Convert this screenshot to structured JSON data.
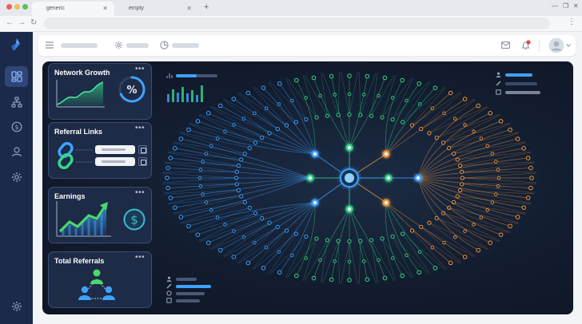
{
  "browser": {
    "tabs": [
      {
        "label": "generic",
        "active": true
      },
      {
        "label": "empty",
        "active": false
      }
    ],
    "new_tab_icon": "plus-icon",
    "window_controls": [
      "minimize-icon",
      "restore-icon",
      "close-icon"
    ],
    "traffic_light_colors": [
      "#ee5f57",
      "#f5bd4f",
      "#5ac05a"
    ]
  },
  "sidebar": {
    "logo_icon": "brand-logo-icon",
    "items": [
      {
        "icon": "dashboard-icon",
        "active": true
      },
      {
        "icon": "network-icon",
        "active": false
      },
      {
        "icon": "dollar-icon",
        "active": false
      },
      {
        "icon": "user-icon",
        "active": false
      },
      {
        "icon": "settings-icon",
        "active": false
      }
    ],
    "bottom_icon": "settings-icon"
  },
  "header": {
    "menu_icon": "hamburger-icon",
    "items": [
      "gear-icon",
      "chart-icon"
    ],
    "right_icons": [
      "mail-icon",
      "bell-icon",
      "avatar",
      "chevron-down-icon"
    ],
    "notification_color": "#e8453c"
  },
  "cards": [
    {
      "title": "Network Growth",
      "badge": "%",
      "icon": "area-chart-icon"
    },
    {
      "title": "Referral Links",
      "icon": "link-icon"
    },
    {
      "title": "Earnings",
      "icon": "trend-up-icon",
      "badge_icon": "dollar-icon"
    },
    {
      "title": "Total Referrals",
      "icon": "group-icon"
    }
  ],
  "card_more": "•••",
  "colors": {
    "blue": "#3ea2ff",
    "green": "#35d889",
    "orange": "#f59a3b",
    "accent_green": "#4ad66d"
  }
}
